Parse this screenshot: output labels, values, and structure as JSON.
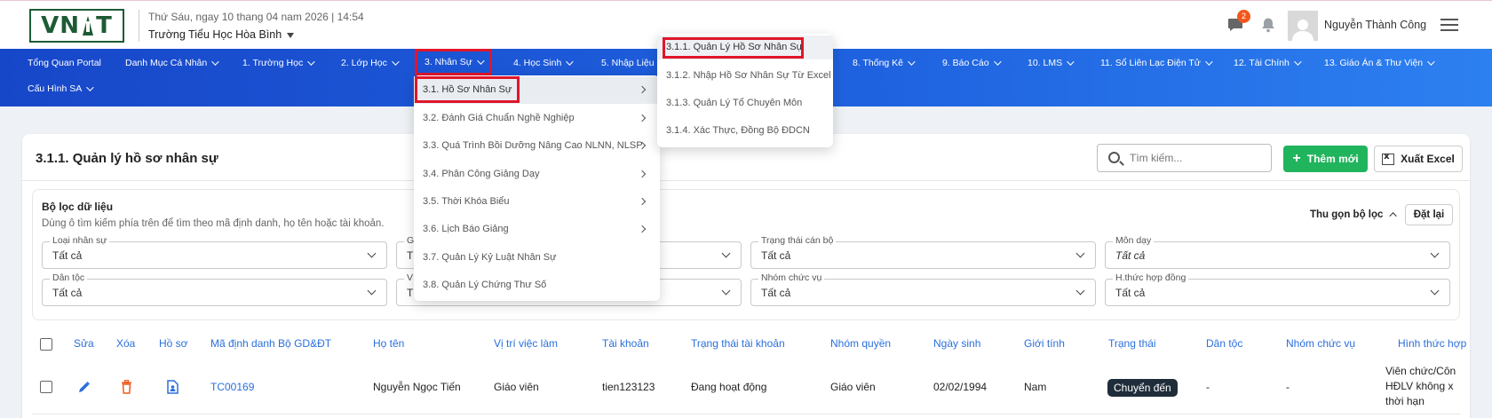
{
  "header": {
    "logo_text_left": "VN",
    "logo_text_right": "T",
    "datetime": "Thứ Sáu, ngay 10 thang 04 nam 2026 | 14:54",
    "school": "Trường Tiểu Học Hòa Bình",
    "notification_count": "2",
    "user_name": "Nguyễn Thành Công"
  },
  "nav": {
    "items": [
      "Tổng Quan Portal",
      "Danh Mục Cá Nhân",
      "1. Trường Học",
      "2. Lớp Học",
      "3. Nhân Sự",
      "4. Học Sinh",
      "5. Nhập Liệu",
      "8. Thống Kê",
      "9. Báo Cáo",
      "10. LMS",
      "11. Sổ Liên Lạc Điện Tử",
      "12. Tài Chính",
      "13. Giáo Án & Thư Viện",
      "Cấu Hình SA"
    ],
    "active": "3. Nhân Sự"
  },
  "menu_level1": {
    "items": [
      "3.1. Hồ Sơ Nhân Sự",
      "3.2. Đánh Giá Chuẩn Nghề Nghiệp",
      "3.3. Quá Trình Bồi Dưỡng Nâng Cao NLNN, NLSP",
      "3.4. Phân Công Giảng Dạy",
      "3.5. Thời Khóa Biểu",
      "3.6. Lịch Báo Giảng",
      "3.7. Quản Lý Kỷ Luật Nhân Sự",
      "3.8. Quản Lý Chứng Thư Số"
    ]
  },
  "menu_level2": {
    "items": [
      "3.1.1. Quản Lý Hồ Sơ Nhân Sự",
      "3.1.2. Nhập Hồ Sơ Nhân Sự Từ Excel",
      "3.1.3. Quản Lý Tổ Chuyên Môn",
      "3.1.4. Xác Thực, Đồng Bộ ĐDCN"
    ]
  },
  "page": {
    "title": "3.1.1. Quản lý hồ sơ nhân sự",
    "search_placeholder": "Tìm kiếm...",
    "add_label": "Thêm mới",
    "export_label": "Xuất Excel"
  },
  "filter": {
    "title": "Bộ lọc dữ liệu",
    "hint": "Dùng ô tìm kiếm phía trên để tìm theo mã định danh, họ tên hoặc tài khoản.",
    "collapse_label": "Thu gọn bộ lọc",
    "reset_label": "Đặt lại",
    "fields": [
      {
        "label": "Loại nhân sự",
        "value": "Tất cả"
      },
      {
        "label": "G",
        "value": "T"
      },
      {
        "label": "",
        "value": ""
      },
      {
        "label": "Trạng thái cán bộ",
        "value": "Tất cả"
      },
      {
        "label": "Môn dạy",
        "value": "Tất cả"
      },
      {
        "label": "Dân tộc",
        "value": "Tất cả"
      },
      {
        "label": "V",
        "value": "T"
      },
      {
        "label": "",
        "value": ""
      },
      {
        "label": "Nhóm chức vụ",
        "value": "Tất cả"
      },
      {
        "label": "H.thức hợp đồng",
        "value": "Tất cả"
      }
    ]
  },
  "table": {
    "headers": [
      "Sửa",
      "Xóa",
      "Hồ sơ",
      "Mã định danh Bộ GD&ĐT",
      "Họ tên",
      "Vị trí việc làm",
      "Tài khoản",
      "Trạng thái tài khoản",
      "Nhóm quyền",
      "Ngày sinh",
      "Giới tính",
      "Trạng thái",
      "Dân tộc",
      "Nhóm chức vụ",
      "Hình thức hợp"
    ],
    "row": {
      "id": "TC00169",
      "name": "Nguyễn Ngọc Tiến",
      "position": "Giáo viên",
      "account": "tien123123",
      "account_status": "Đang hoạt động",
      "role": "Giáo viên",
      "dob": "02/02/1994",
      "gender": "Nam",
      "status": "Chuyển đến",
      "ethnicity": "-",
      "position_group": "-",
      "contract_lines": [
        "Viên chức/Côn",
        "HĐLV không x",
        "thời hạn"
      ]
    }
  },
  "colors": {
    "nav_start": "#1747c9",
    "nav_end": "#2d80f0",
    "accent_blue": "#2a6fdb",
    "green": "#20b45d",
    "highlight_red": "#e0162b"
  }
}
